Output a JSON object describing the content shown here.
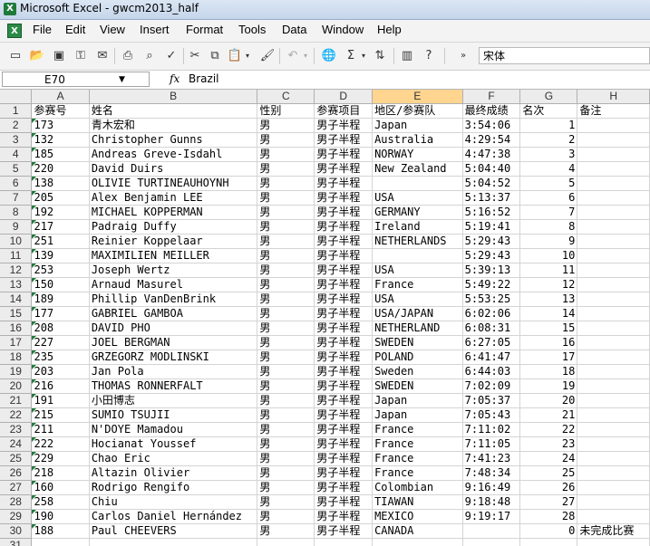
{
  "window": {
    "title": "Microsoft Excel - gwcm2013_half"
  },
  "menu": [
    "File",
    "Edit",
    "View",
    "Insert",
    "Format",
    "Tools",
    "Data",
    "Window",
    "Help"
  ],
  "toolbar": {
    "font_name": "宋体"
  },
  "formula_bar": {
    "cell_ref": "E70",
    "fx_label": "fx",
    "content": "Brazil"
  },
  "sheet": {
    "columns": [
      "A",
      "B",
      "C",
      "D",
      "E",
      "F",
      "G",
      "H"
    ],
    "selected_column": "E",
    "rows": [
      {
        "n": "1",
        "cells": [
          "参赛号",
          "姓名",
          "性别",
          "参赛项目",
          "地区/参赛队",
          "最终成绩",
          "名次",
          "备注"
        ]
      },
      {
        "n": "2",
        "cells": [
          "173",
          "青木宏和",
          "男",
          "男子半程",
          "Japan",
          "3:54:06",
          "1",
          ""
        ]
      },
      {
        "n": "3",
        "cells": [
          "132",
          "Christopher Gunns",
          "男",
          "男子半程",
          "Australia",
          "4:29:54",
          "2",
          ""
        ]
      },
      {
        "n": "4",
        "cells": [
          "185",
          "Andreas Greve-Isdahl",
          "男",
          "男子半程",
          "NORWAY",
          "4:47:38",
          "3",
          ""
        ]
      },
      {
        "n": "5",
        "cells": [
          "220",
          "David Duirs",
          "男",
          "男子半程",
          "New Zealand",
          "5:04:40",
          "4",
          ""
        ]
      },
      {
        "n": "6",
        "cells": [
          "138",
          "OLIVIE TURTINEAUHOYNH",
          "男",
          "男子半程",
          "",
          "5:04:52",
          "5",
          ""
        ]
      },
      {
        "n": "7",
        "cells": [
          "205",
          "Alex Benjamin LEE",
          "男",
          "男子半程",
          "USA",
          "5:13:37",
          "6",
          ""
        ]
      },
      {
        "n": "8",
        "cells": [
          "192",
          "MICHAEL KOPPERMAN",
          "男",
          "男子半程",
          "GERMANY",
          "5:16:52",
          "7",
          ""
        ]
      },
      {
        "n": "9",
        "cells": [
          "217",
          "Padraig Duffy",
          "男",
          "男子半程",
          "Ireland",
          "5:19:41",
          "8",
          ""
        ]
      },
      {
        "n": "10",
        "cells": [
          "251",
          "Reinier Koppelaar",
          "男",
          "男子半程",
          "NETHERLANDS",
          "5:29:43",
          "9",
          ""
        ]
      },
      {
        "n": "11",
        "cells": [
          "139",
          "MAXIMILIEN MEILLER",
          "男",
          "男子半程",
          "",
          "5:29:43",
          "10",
          ""
        ]
      },
      {
        "n": "12",
        "cells": [
          "253",
          "Joseph Wertz",
          "男",
          "男子半程",
          "USA",
          "5:39:13",
          "11",
          ""
        ]
      },
      {
        "n": "13",
        "cells": [
          "150",
          "Arnaud Masurel",
          "男",
          "男子半程",
          "France",
          "5:49:22",
          "12",
          ""
        ]
      },
      {
        "n": "14",
        "cells": [
          "189",
          "Phillip VanDenBrink",
          "男",
          "男子半程",
          "USA",
          "5:53:25",
          "13",
          ""
        ]
      },
      {
        "n": "15",
        "cells": [
          "177",
          "GABRIEL GAMBOA",
          "男",
          "男子半程",
          "USA/JAPAN",
          "6:02:06",
          "14",
          ""
        ]
      },
      {
        "n": "16",
        "cells": [
          "208",
          "DAVID PHO",
          "男",
          "男子半程",
          "NETHERLAND",
          "6:08:31",
          "15",
          ""
        ]
      },
      {
        "n": "17",
        "cells": [
          "227",
          "JOEL BERGMAN",
          "男",
          "男子半程",
          "SWEDEN",
          "6:27:05",
          "16",
          ""
        ]
      },
      {
        "n": "18",
        "cells": [
          "235",
          "GRZEGORZ MODLINSKI",
          "男",
          "男子半程",
          "POLAND",
          "6:41:47",
          "17",
          ""
        ]
      },
      {
        "n": "19",
        "cells": [
          "203",
          "Jan Pola",
          "男",
          "男子半程",
          "Sweden",
          "6:44:03",
          "18",
          ""
        ]
      },
      {
        "n": "20",
        "cells": [
          "216",
          "THOMAS RONNERFALT",
          "男",
          "男子半程",
          "SWEDEN",
          "7:02:09",
          "19",
          ""
        ]
      },
      {
        "n": "21",
        "cells": [
          "191",
          "小田博志",
          "男",
          "男子半程",
          "Japan",
          "7:05:37",
          "20",
          ""
        ]
      },
      {
        "n": "22",
        "cells": [
          "215",
          "SUMIO TSUJII",
          "男",
          "男子半程",
          "Japan",
          "7:05:43",
          "21",
          ""
        ]
      },
      {
        "n": "23",
        "cells": [
          "211",
          "N'DOYE  Mamadou",
          "男",
          "男子半程",
          "France",
          "7:11:02",
          "22",
          ""
        ]
      },
      {
        "n": "24",
        "cells": [
          "222",
          "Hocianat Youssef",
          "男",
          "男子半程",
          "France",
          "7:11:05",
          "23",
          ""
        ]
      },
      {
        "n": "25",
        "cells": [
          "229",
          "Chao Eric",
          "男",
          "男子半程",
          "France",
          "7:41:23",
          "24",
          ""
        ]
      },
      {
        "n": "26",
        "cells": [
          "218",
          "Altazin Olivier",
          "男",
          "男子半程",
          "France",
          "7:48:34",
          "25",
          ""
        ]
      },
      {
        "n": "27",
        "cells": [
          "160",
          "Rodrigo Rengifo",
          "男",
          "男子半程",
          "Colombian",
          "9:16:49",
          "26",
          ""
        ]
      },
      {
        "n": "28",
        "cells": [
          "258",
          "Chiu",
          "男",
          "男子半程",
          "TIAWAN",
          "9:18:48",
          "27",
          ""
        ]
      },
      {
        "n": "29",
        "cells": [
          "190",
          "Carlos Daniel Hernández",
          "男",
          "男子半程",
          "MEXICO",
          "9:19:17",
          "28",
          ""
        ]
      },
      {
        "n": "30",
        "cells": [
          "188",
          "Paul CHEEVERS",
          "男",
          "男子半程",
          "CANADA",
          "",
          "0",
          "未完成比赛"
        ]
      },
      {
        "n": "31",
        "cells": [
          "",
          "",
          "",
          "",
          "",
          "",
          "",
          ""
        ]
      }
    ]
  }
}
